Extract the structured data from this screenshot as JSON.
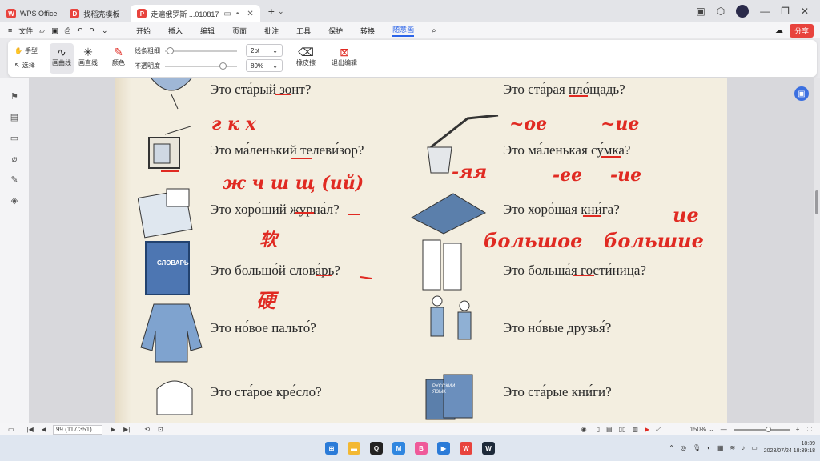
{
  "tabs": [
    {
      "label": "WPS Office",
      "color": "#e8433d",
      "active": false
    },
    {
      "label": "找稻壳模板",
      "color": "#e8433d",
      "active": false
    },
    {
      "label": "走遍俄罗斯 ...010817",
      "color": "#e8433d",
      "active": true
    }
  ],
  "menu": {
    "file": "文件",
    "items": [
      "开始",
      "插入",
      "编辑",
      "页面",
      "批注",
      "工具",
      "保护",
      "转换",
      "随意画"
    ],
    "active": "随意画",
    "share": "分享"
  },
  "toolbar": {
    "hand": "手型",
    "select": "选择",
    "draw_curve": "画曲线",
    "draw_line": "画直线",
    "color": "颜色",
    "line_width_label": "线条粗细",
    "line_width_value": "2pt",
    "opacity_label": "不透明度",
    "opacity_value": "80%",
    "eraser": "橡皮擦",
    "exit": "退出编辑"
  },
  "document": {
    "printed": [
      "Это ста́рый зонт?",
      "Это ста́рая пло́щадь?",
      "Это ма́ленький телеви́зор?",
      "Это ма́ленькая су́мка?",
      "Это хоро́ший журна́л?",
      "Это хоро́шая кни́га?",
      "Это большо́й слова́рь?",
      "Это больша́я гости́ница?",
      "Это но́вое пальто́?",
      "Это но́вые друзья́?",
      "Это ста́рое кре́сло?",
      "Это ста́рые кни́ги?"
    ],
    "handwriting": [
      "г к х",
      "~ое",
      "~ие",
      "ж ч ш щ (ий)",
      "-яя",
      "-ее",
      "-ие",
      "ие",
      "большое",
      "большие",
      "软",
      "硬"
    ],
    "image_labels": [
      "СЛОВАРЬ",
      "РУССКИЙ ЯЗЫК"
    ]
  },
  "status": {
    "page": "99 (117/351)",
    "zoom": "150%"
  },
  "taskbar": {
    "time": "18:39",
    "date": "2023/07/24 18:39:18"
  }
}
